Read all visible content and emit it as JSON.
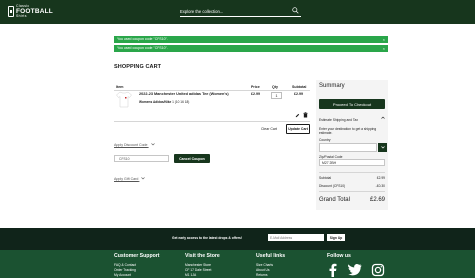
{
  "header": {
    "logo": {
      "line1": "Classic",
      "line2": "FOOTBALL",
      "line3": "Shirts"
    },
    "search_placeholder": "Explore the collection..."
  },
  "alerts": [
    {
      "text": "You used coupon code \"CFS10\".",
      "close": "×"
    },
    {
      "text": "You used coupon code \"CFS10\".",
      "close": "×"
    }
  ],
  "cart": {
    "title": "SHOPPING CART",
    "columns": {
      "item": "Item",
      "price": "Price",
      "qty": "Qty",
      "subtotal": "Subtotal"
    },
    "item": {
      "name": "2022-23 Manchester United adidas Tee (Women's)",
      "sub_label": "Womens Adidas/Nike",
      "sub_value": "1 (10 16 18)",
      "price": "£2.99",
      "qty": "1",
      "subtotal": "£2.99"
    },
    "clear_cart": "Clear Cart",
    "update_cart": "Update Cart",
    "apply_discount": "Apply Discount Code",
    "coupon_code": "CFS10",
    "cancel_coupon": "Cancel Coupon",
    "apply_gift": "Apply Gift Card"
  },
  "summary": {
    "title": "Summary",
    "proceed": "Proceed To Checkout",
    "estimate_label": "Estimate Shipping and Tax",
    "estimate_text": "Enter your destination to get a shipping estimate.",
    "country_label": "Country",
    "zip_label": "Zip/Postal Code",
    "zip_value": "M27 2BH",
    "subtotal_label": "Subtotal",
    "subtotal_value": "£2.99",
    "discount_label": "Discount (CFS10)",
    "discount_value": "-£0.30",
    "grand_label": "Grand Total",
    "grand_value": "£2.69"
  },
  "newsletter": {
    "text": "Get early access to the latest drops & offers!",
    "placeholder": "E-Mail Address",
    "button": "Sign Up"
  },
  "footer": {
    "support": {
      "title": "Customer Support",
      "links": [
        "FAQ & Contact",
        "Order Tracking",
        "My Account"
      ]
    },
    "store": {
      "title": "Visit the Store",
      "links": [
        "Manchester Store",
        "CF 17 Dale Street",
        "M1 1JA"
      ]
    },
    "useful": {
      "title": "Useful links",
      "links": [
        "Size Charts",
        "About Us",
        "Returns"
      ]
    },
    "follow": {
      "title": "Follow us"
    }
  },
  "colors": {
    "brand_dark": "#17361d",
    "alert_green": "#2aa64a",
    "footer_green": "#1b5231",
    "newsletter_dark": "#10241a"
  },
  "icons": [
    "search-icon",
    "edit-icon",
    "trash-icon",
    "chevron-down-icon",
    "chevron-up-icon",
    "facebook-icon",
    "twitter-icon",
    "instagram-icon"
  ]
}
